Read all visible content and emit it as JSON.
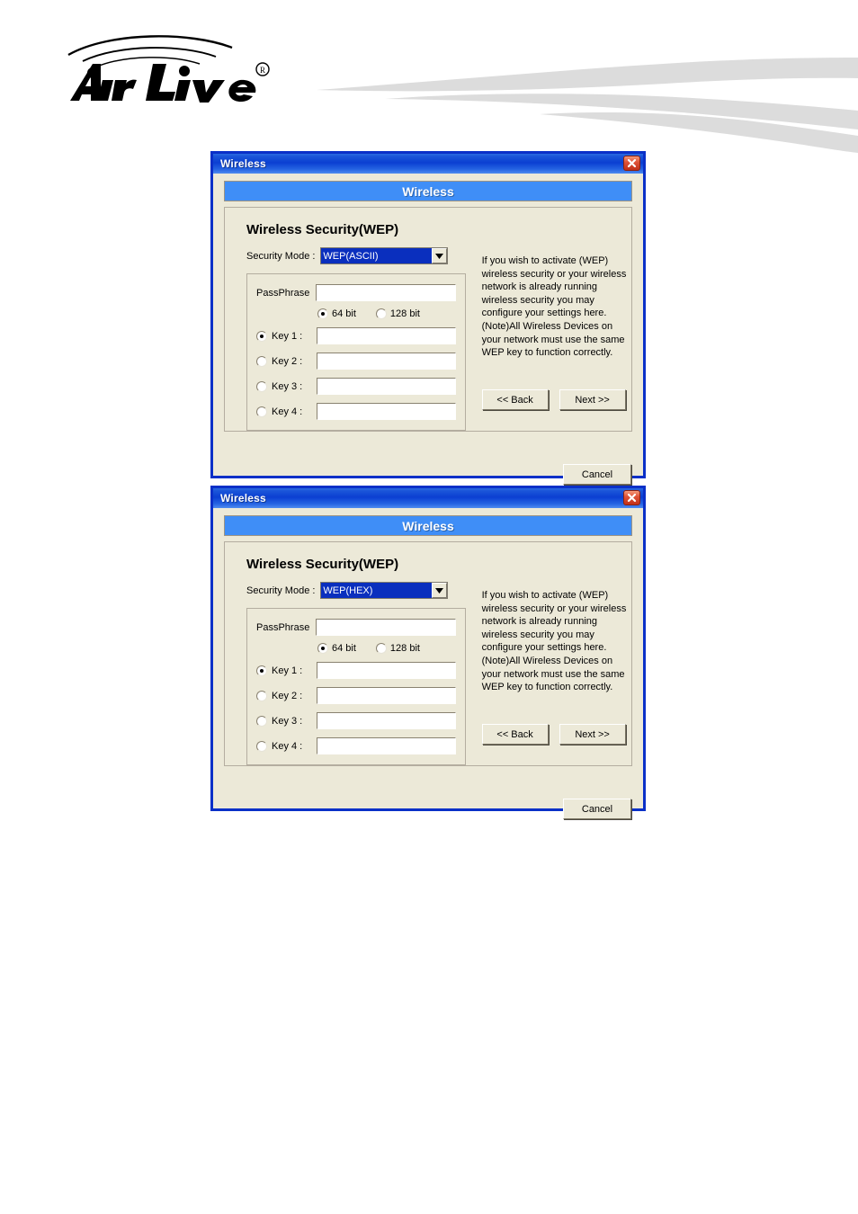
{
  "brand": {
    "name": "Air Live",
    "trademark": "®"
  },
  "dialogs": [
    {
      "titlebar": "Wireless",
      "close_icon": "close-icon",
      "banner": "Wireless",
      "panel_title": "Wireless Security(WEP)",
      "security_mode_label": "Security Mode :",
      "security_mode_value": "WEP(ASCII)",
      "dropdown_icon": "chevron-down-icon",
      "passphrase_label": "PassPhrase",
      "passphrase_value": "",
      "bits": [
        {
          "label": "64 bit",
          "checked": true
        },
        {
          "label": "128 bit",
          "checked": false
        }
      ],
      "keys": [
        {
          "label": "Key 1 :",
          "checked": true,
          "value": ""
        },
        {
          "label": "Key 2 :",
          "checked": false,
          "value": ""
        },
        {
          "label": "Key 3 :",
          "checked": false,
          "value": ""
        },
        {
          "label": "Key 4 :",
          "checked": false,
          "value": ""
        }
      ],
      "help_text": "If you wish to activate (WEP) wireless security or your wireless network is already running wireless security you may configure your settings here. (Note)All Wireless Devices on your network must use the same WEP key to function correctly.",
      "back_label": "<< Back",
      "next_label": "Next >>",
      "cancel_label": "Cancel"
    },
    {
      "titlebar": "Wireless",
      "close_icon": "close-icon",
      "banner": "Wireless",
      "panel_title": "Wireless Security(WEP)",
      "security_mode_label": "Security Mode :",
      "security_mode_value": "WEP(HEX)",
      "dropdown_icon": "chevron-down-icon",
      "passphrase_label": "PassPhrase",
      "passphrase_value": "",
      "bits": [
        {
          "label": "64 bit",
          "checked": true
        },
        {
          "label": "128 bit",
          "checked": false
        }
      ],
      "keys": [
        {
          "label": "Key 1 :",
          "checked": true,
          "value": ""
        },
        {
          "label": "Key 2 :",
          "checked": false,
          "value": ""
        },
        {
          "label": "Key 3 :",
          "checked": false,
          "value": ""
        },
        {
          "label": "Key 4 :",
          "checked": false,
          "value": ""
        }
      ],
      "help_text": "If you wish to activate (WEP) wireless security or your wireless network is already running wireless security you may configure your settings here. (Note)All Wireless Devices on your network must use the same WEP key to function correctly.",
      "back_label": "<< Back",
      "next_label": "Next >>",
      "cancel_label": "Cancel"
    }
  ],
  "colors": {
    "titlebar_blue": "#0b3fd2",
    "banner_blue": "#3f8ef7",
    "dialog_border": "#0a30c8",
    "dialog_face": "#ece9d8",
    "combo_selected": "#0a2fbe",
    "close_red": "#c02f18",
    "swoosh_gray": "#dcdcdc"
  }
}
